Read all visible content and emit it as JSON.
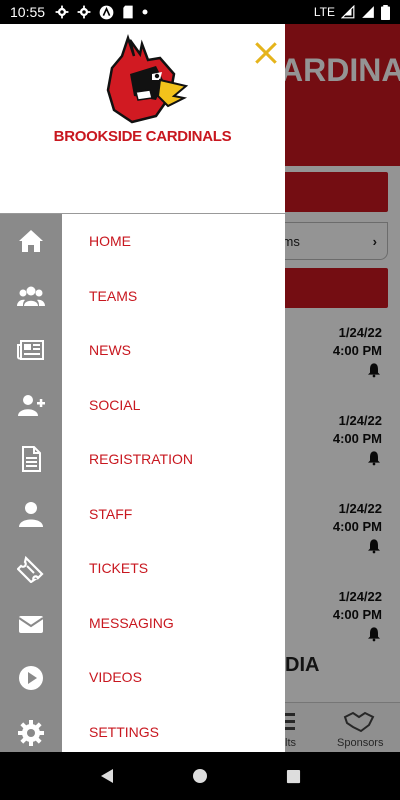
{
  "status_bar": {
    "time": "10:55",
    "network": "LTE",
    "icons": [
      "settings-icon",
      "settings-icon",
      "a-icon",
      "sd-card-icon",
      "dot-icon",
      "wifi-icon",
      "signal-icon",
      "battery-icon"
    ]
  },
  "background": {
    "header_title": "ARDINALS",
    "forms_text": "orms",
    "games": [
      {
        "date": "1/24/22",
        "time": "4:00 PM"
      },
      {
        "date": "1/24/22",
        "time": "4:00 PM"
      },
      {
        "date": "1/24/22",
        "time": "4:00 PM"
      },
      {
        "date": "1/24/22",
        "time": "4:00 PM"
      }
    ],
    "media_text": "DIA",
    "bottom_nav": {
      "results": "lts",
      "sponsors": "Sponsors"
    }
  },
  "drawer": {
    "school_name": "BROOKSIDE CARDINALS",
    "menu": [
      {
        "label": "HOME",
        "icon": "home-icon"
      },
      {
        "label": "TEAMS",
        "icon": "group-icon"
      },
      {
        "label": "NEWS",
        "icon": "newspaper-icon"
      },
      {
        "label": "SOCIAL",
        "icon": "add-user-icon"
      },
      {
        "label": "REGISTRATION",
        "icon": "document-icon"
      },
      {
        "label": "STAFF",
        "icon": "person-icon"
      },
      {
        "label": "TICKETS",
        "icon": "ticket-icon"
      },
      {
        "label": "MESSAGING",
        "icon": "envelope-icon"
      },
      {
        "label": "VIDEOS",
        "icon": "play-icon"
      },
      {
        "label": "SETTINGS",
        "icon": "gear-icon"
      }
    ]
  },
  "colors": {
    "brand_red": "#c8171f",
    "close_yellow": "#e5b41b",
    "rail_gray": "#8a8a8a"
  }
}
